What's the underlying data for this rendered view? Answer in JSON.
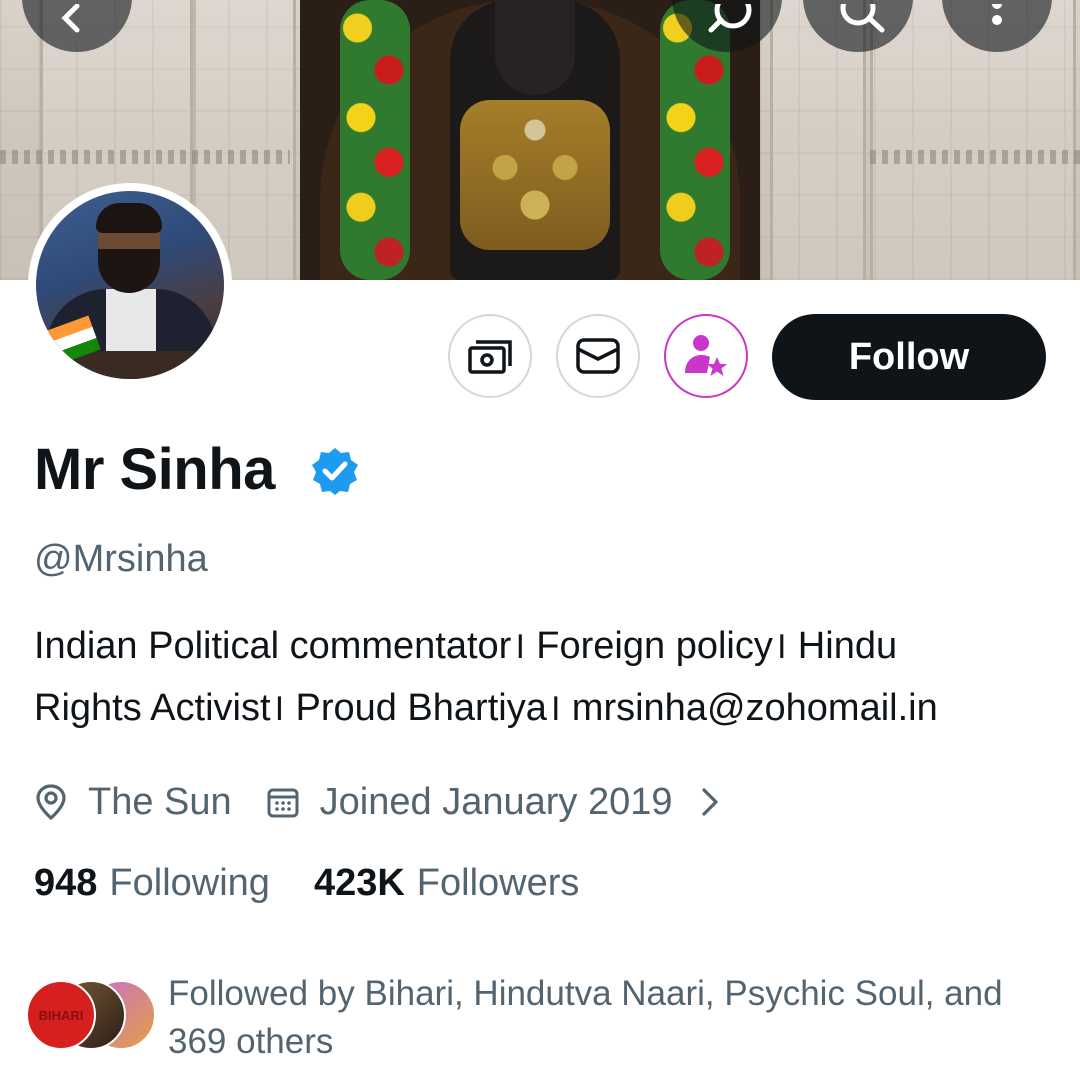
{
  "profile": {
    "name": "Mr Sinha",
    "handle": "@Mrsinha",
    "bio_line1": "Indian Political commentator। Foreign policy। Hindu",
    "bio_line2": "Rights Activist। Proud Bhartiya। mrsinha@zohomail.in",
    "location": "The Sun",
    "joined": "Joined January 2019",
    "following_count": "948",
    "following_label": "Following",
    "followers_count": "423K",
    "followers_label": "Followers",
    "followed_by_line1": "Followed by Bihari, Hindutva Naari, Psychic Soul, and",
    "followed_by_line2": "369 others"
  },
  "actions": {
    "follow_label": "Follow",
    "follower_avatar_text": "BIHARI"
  },
  "colors": {
    "verified_blue": "#1d9bf0",
    "subscribe_purple": "#c936c9",
    "text_primary": "#0f1419",
    "text_secondary": "#536471"
  },
  "icons": [
    "back-arrow-icon",
    "grok-icon",
    "search-icon",
    "more-icon",
    "tip-jar-icon",
    "message-icon",
    "subscribe-icon",
    "verified-badge-icon",
    "location-icon",
    "calendar-icon",
    "chevron-right-icon"
  ]
}
